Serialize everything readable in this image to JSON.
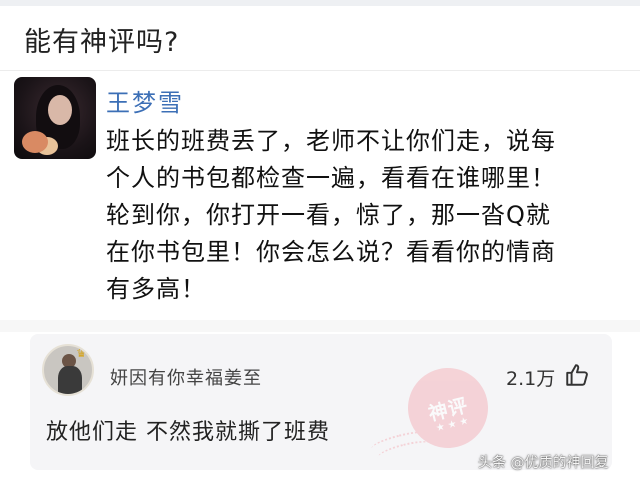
{
  "question": {
    "text": "能有神评吗?"
  },
  "post": {
    "author": "王梦雪",
    "lines": [
      "班长的班费丢了，老师不让你们走，说每",
      "个人的书包都检查一遍，看看在谁哪里！",
      "轮到你，你打开一看，惊了，那一沓Q就",
      "在你书包里！你会怎么说？看看你的情商",
      "有多高！"
    ]
  },
  "comment": {
    "username": "妍因有你幸福姜至",
    "likes": "2.1万",
    "text": "放他们走 不然我就撕了班费",
    "stamp_text": "神评",
    "stamp_stars": "★ ★ ★"
  },
  "watermark": {
    "text": "头条 @优质的神回复"
  },
  "icons": {
    "like": "thumbs-up-icon",
    "crown": "crown-icon"
  },
  "colors": {
    "author": "#3c6fb6",
    "stamp": "#f4b6bd",
    "card_bg": "#f5f5f7"
  }
}
